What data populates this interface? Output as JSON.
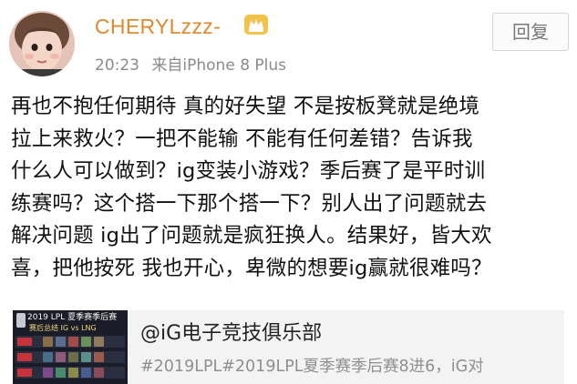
{
  "post": {
    "username": "CHERYLzzz-",
    "time": "20:23",
    "source": "来自iPhone 8 Plus",
    "reply_label": "回复",
    "body_lines": [
      "再也不抱任何期待 真的好失望 不是按板凳就是绝境",
      "拉上来救火？一把不能输 不能有任何差错？告诉我",
      "什么人可以做到？ig变装小游戏？季后赛了是平时训",
      "练赛吗？这个搭一下那个搭一下？别人出了问题就去",
      "解决问题 ig出了问题就是疯狂换人。结果好，皆大欢",
      "喜，把他按死 我也开心，卑微的想要ig赢就很难吗？"
    ]
  },
  "shared": {
    "title": "@iG电子竞技俱乐部",
    "description": "#2019LPL#2019LPL夏季赛季后赛8进6，iG对",
    "thumb_title": "2019 LPL 夏季赛季后赛",
    "thumb_subtitle": "赛后总结 IG vs LNG"
  },
  "colors": {
    "username": "#e0892d",
    "meta": "#8a8a8a",
    "card_bg": "#f3f3f3"
  },
  "icons": {
    "vip": "crown-badge-icon",
    "avatar": "child-photo-avatar"
  }
}
